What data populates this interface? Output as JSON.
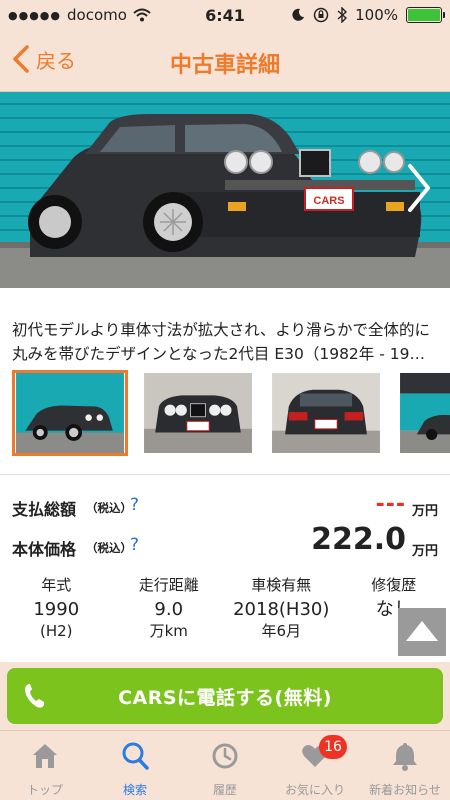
{
  "status_bar": {
    "signal_dots": "●●●●●",
    "carrier": "docomo",
    "time": "6:41",
    "battery_percent": "100%"
  },
  "nav": {
    "back_label": "戻る",
    "title": "中古車詳細"
  },
  "hero": {
    "plate_text": "CARS",
    "next_icon": "chevron-right-icon"
  },
  "description": "初代モデルより車体寸法が拡大され、より滑らかで全体的に丸みを帯びたデザインとなった2代目 E30（1982年 - 19…",
  "thumbnails": [
    {
      "selected": true
    },
    {
      "selected": false
    },
    {
      "selected": false
    },
    {
      "selected": false
    }
  ],
  "prices": {
    "total": {
      "label": "支払総額",
      "tax": "（税込）",
      "help": "?",
      "value": "---",
      "unit": "万円"
    },
    "body": {
      "label": "本体価格",
      "tax": "（税込）",
      "help": "?",
      "value": "222.0",
      "unit": "万円"
    }
  },
  "specs": [
    {
      "label": "年式",
      "value": "1990",
      "sub": "(H2)"
    },
    {
      "label": "走行距離",
      "value": "9.0",
      "sub": "万km"
    },
    {
      "label": "車検有無",
      "value": "2018(H30)",
      "sub": "年6月"
    },
    {
      "label": "修復歴",
      "value": "なし",
      "sub": ""
    }
  ],
  "call_button": {
    "label": "CARSに電話する(無料)"
  },
  "tabs": [
    {
      "label": "トップ",
      "icon": "home-icon",
      "active": false
    },
    {
      "label": "検索",
      "icon": "search-icon",
      "active": true
    },
    {
      "label": "履歴",
      "icon": "clock-icon",
      "active": false
    },
    {
      "label": "お気に入り",
      "icon": "heart-icon",
      "active": false,
      "badge": "16"
    },
    {
      "label": "新着お知らせ",
      "icon": "bell-icon",
      "active": false
    }
  ],
  "colors": {
    "accent": "#f07a2b",
    "header_bg": "#f6e3d6",
    "call_green": "#7dc31e",
    "active_tab": "#2b7be0",
    "price_red": "#e53222"
  }
}
